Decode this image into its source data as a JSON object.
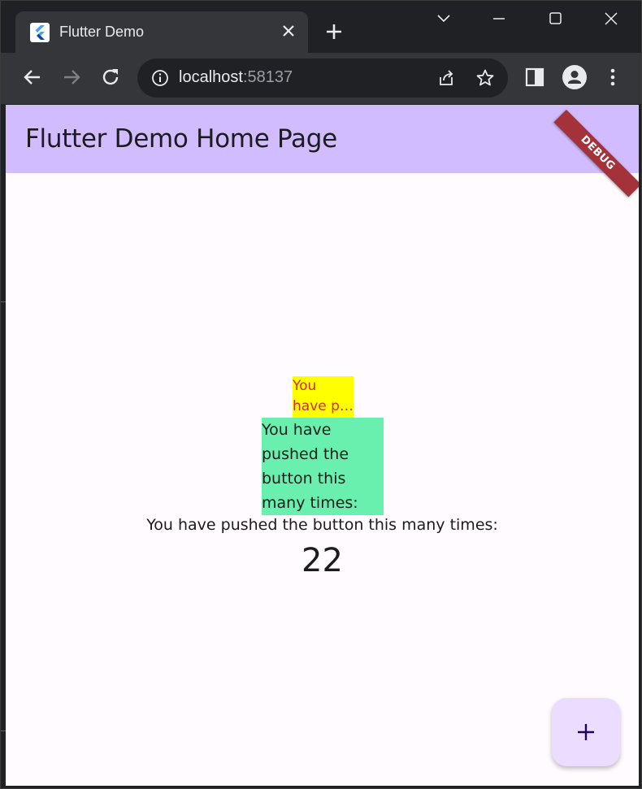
{
  "browser": {
    "tab_title": "Flutter Demo",
    "url_host": "localhost",
    "url_port": ":58137"
  },
  "app": {
    "appbar_title": "Flutter Demo Home Page",
    "debug_banner": "DEBUG",
    "yellow_line1": "You",
    "yellow_line2": "have p…",
    "green_text": "You have pushed the button this many times:",
    "full_text": "You have pushed the button this many times:",
    "counter": "22"
  },
  "colors": {
    "appbar": "#d0bcff",
    "yellow_box": "#ffff00",
    "green_box": "#69f0ae",
    "fab": "#eaddff",
    "debug_banner": "#a3323a"
  },
  "icons": {
    "favicon": "flutter-logo-icon",
    "tab_close": "close-icon",
    "new_tab": "plus-icon",
    "back": "arrow-left-icon",
    "forward": "arrow-right-icon",
    "reload": "reload-icon",
    "site_info": "info-icon",
    "share": "share-icon",
    "bookmark": "star-icon",
    "side_panel": "side-panel-icon",
    "profile": "profile-icon",
    "menu": "kebab-menu-icon",
    "fab": "plus-icon"
  }
}
